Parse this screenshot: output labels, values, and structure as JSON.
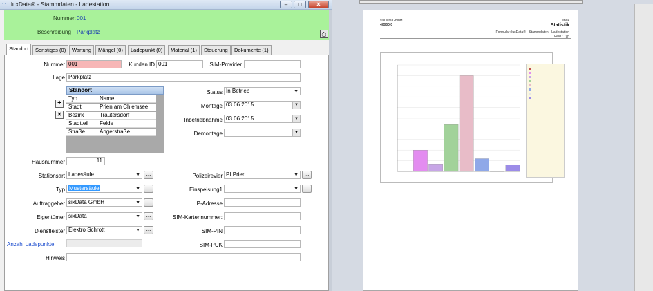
{
  "window": {
    "title": "luxData® - Stammdaten - Ladestation",
    "controls": {
      "minimize": "–",
      "maximize": "□",
      "close": "✕"
    }
  },
  "header": {
    "nummer_label": "Nummer:",
    "nummer_value": "001",
    "beschreibung_label": "Beschreibung",
    "beschreibung_value": "Parkplatz"
  },
  "tabs": [
    {
      "label": "Standort",
      "active": true
    },
    {
      "label": "Sonstiges (0)"
    },
    {
      "label": "Wartung"
    },
    {
      "label": "Mängel (0)"
    },
    {
      "label": "Ladepunkt (0)"
    },
    {
      "label": "Material (1)"
    },
    {
      "label": "Steuerung"
    },
    {
      "label": "Dokumente (1)"
    }
  ],
  "form": {
    "nummer_label": "Nummer",
    "nummer_value": "001",
    "kunden_id_label": "Kunden ID",
    "kunden_id_value": "001",
    "sim_provider_label": "SIM-Provider",
    "sim_provider_value": "",
    "lage_label": "Lage",
    "lage_value": "Parkplatz",
    "status_label": "Status",
    "status_value": "In Betrieb",
    "montage_label": "Montage",
    "montage_value": "03.06.2015",
    "inbetriebnahme_label": "Inbetriebnahme",
    "inbetriebnahme_value": "03.06.2015",
    "demontage_label": "Demontage",
    "demontage_value": "",
    "hausnummer_label": "Hausnummer",
    "hausnummer_value": "11",
    "stationsart_label": "Stationsart",
    "stationsart_value": "Ladesäule",
    "typ_label": "Typ",
    "typ_value": "Mustersäule",
    "auftraggeber_label": "Auftraggeber",
    "auftraggeber_value": "sixData GmbH",
    "eigentuemer_label": "Eigentümer",
    "eigentuemer_value": "sixData",
    "dienstleister_label": "Dienstleister",
    "dienstleister_value": "Elektro Schrott",
    "anzahl_ladepunkte_label": "Anzahl Ladepunkte",
    "hinweis_label": "Hinweis",
    "hinweis_value": "",
    "polizeirevier_label": "Polizeirevier",
    "polizeirevier_value": "PI Prien",
    "einspeisung_label": "Einspeisung1",
    "einspeisung_value": "",
    "ip_adresse_label": "IP-Adresse",
    "sim_kartennummer_label": "SIM-Kartennummer:",
    "sim_pin_label": "SIM-PIN",
    "sim_puk_label": "SIM-PUK",
    "ellipsis": "...",
    "add": "+",
    "remove": "✕"
  },
  "standort_grid": {
    "title": "Standort",
    "columns": [
      "Typ",
      "Name"
    ],
    "rows": [
      [
        "Stadt",
        "Prien am Chiemsee"
      ],
      [
        "Bezirk",
        "Trautersdorf"
      ],
      [
        "Stadtteil",
        "Felde"
      ],
      [
        "Straße",
        "Angerstraße"
      ]
    ]
  },
  "report": {
    "company": "sixData GmbH",
    "company_id": "40000.0",
    "right_top": "ebox",
    "title": "Statistik",
    "form_line": "Formular: luxData® - Stammdaten - Ladestation",
    "sub_line": "Feld : Typ"
  },
  "chart_data": {
    "type": "bar",
    "values": [
      0.5,
      20,
      7,
      44,
      90,
      12,
      0,
      6
    ],
    "colors": [
      "#c0504d",
      "#e38cf0",
      "#c7a6e6",
      "#a2d29a",
      "#e8bcc8",
      "#8fa8e8",
      "#e6e6e6",
      "#9c8ce8"
    ],
    "ylim": [
      0,
      100
    ]
  },
  "colors": {
    "header_green": "#a9f29a",
    "pink_field": "#f7b6b6",
    "link_blue": "#1f4fcf"
  }
}
